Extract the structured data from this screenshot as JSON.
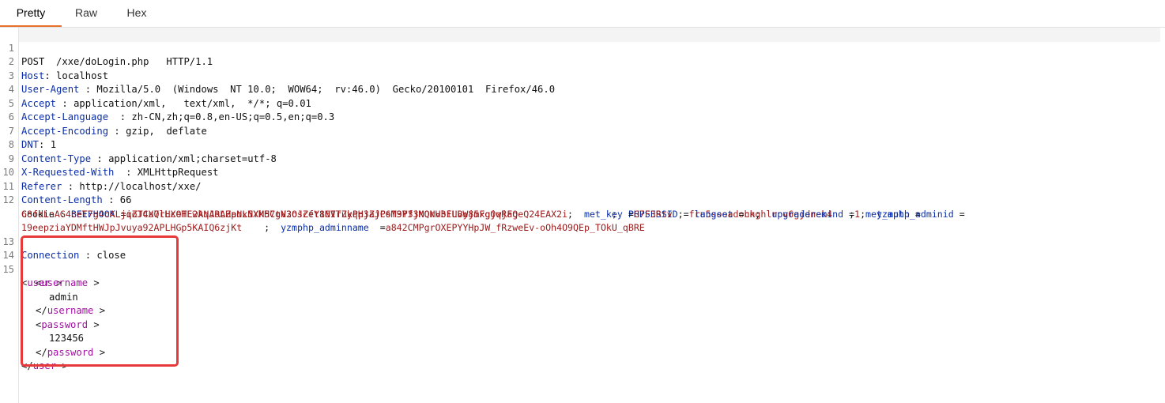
{
  "tabs": [
    {
      "label": "Pretty"
    },
    {
      "label": "Raw"
    },
    {
      "label": "Hex"
    }
  ],
  "request": {
    "line_numbers": [
      "1",
      "2",
      "3",
      "4",
      "5",
      "6",
      "7",
      "8",
      "9",
      "10",
      "11",
      "12",
      "13",
      "14",
      "15"
    ],
    "request_line": "POST  /xxe/doLogin.php   HTTP/1.1",
    "headers": [
      {
        "name": "Host",
        "sep": ":",
        "value": "localhost"
      },
      {
        "name": "User-Agent",
        "sep": " :",
        "value": "Mozilla/5.0  (Windows  NT 10.0;  WOW64;  rv:46.0)  Gecko/20100101  Firefox/46.0"
      },
      {
        "name": "Accept",
        "sep": " :",
        "value": "application/xml,   text/xml,  */*; q=0.01"
      },
      {
        "name": "Accept-Language",
        "sep": "  :",
        "value": "zh-CN,zh;q=0.8,en-US;q=0.5,en;q=0.3"
      },
      {
        "name": "Accept-Encoding",
        "sep": " :",
        "value": "gzip,  deflate"
      },
      {
        "name": "DNT",
        "sep": ":",
        "value": "1"
      },
      {
        "name": "Content-Type",
        "sep": " :",
        "value": "application/xml;charset=utf-8"
      },
      {
        "name": "X-Requested-With",
        "sep": "  :",
        "value": "XMLHttpRequest"
      },
      {
        "name": "Referer",
        "sep": " :",
        "value": "http://localhost/xxe/"
      },
      {
        "name": "Content-Length",
        "sep": " :",
        "value": "66"
      }
    ],
    "cookie": {
      "name": "Cookie",
      "sep": " :",
      "pairs": [
        {
          "k": "BEEFHOOK",
          "v": "qZJ4uQlHXeTLwkqARAHaoLNYMHCtV2OscfY86ITuyPp3aJCsT9YfjNQrH3FLByj5xgjwjaQeQ24EAX2i"
        },
        {
          "k": "PHPSESSID",
          "v": "fru5sooadohkghlrpv6gjdnek4"
        },
        {
          "k": "met_auth",
          "v": "68fdLnAG4ceT7g4cALjioTCX7rLcOHE2ANJoLZpNx5Xk57gN3oJZet1NVrZkqHjZjP6M3P33MONvbiUvW8mFgOqRFg"
        },
        {
          "k": "met_key",
          "v": "G7F3Rtv"
        },
        {
          "k": "langset",
          "v": "cn"
        },
        {
          "k": "upgraderemind",
          "v": "1"
        },
        {
          "k": "yzmphp_adminid",
          "v": "19eepziaYDMftHWJpJvuya92APLHGp5KAIQ6zjKt"
        },
        {
          "k": "yzmphp_adminname",
          "v": "a842CMPgrOXEPYYHpJW_fRzweEv-oOh4O9QEp_TOkU_qBRE"
        }
      ]
    },
    "connection": {
      "name": "Connection",
      "sep": " :",
      "value": "close"
    },
    "body": {
      "user_open": "user",
      "username_tag": "username",
      "username_value": "admin",
      "password_tag": "password",
      "password_value": "123456"
    }
  },
  "colors": {
    "header_name": "#0b2ea8",
    "cookie_value": "#9c1a1a",
    "xml_tag": "#a012a0",
    "highlight": "#e8393a",
    "active_tab": "#e8702a"
  }
}
